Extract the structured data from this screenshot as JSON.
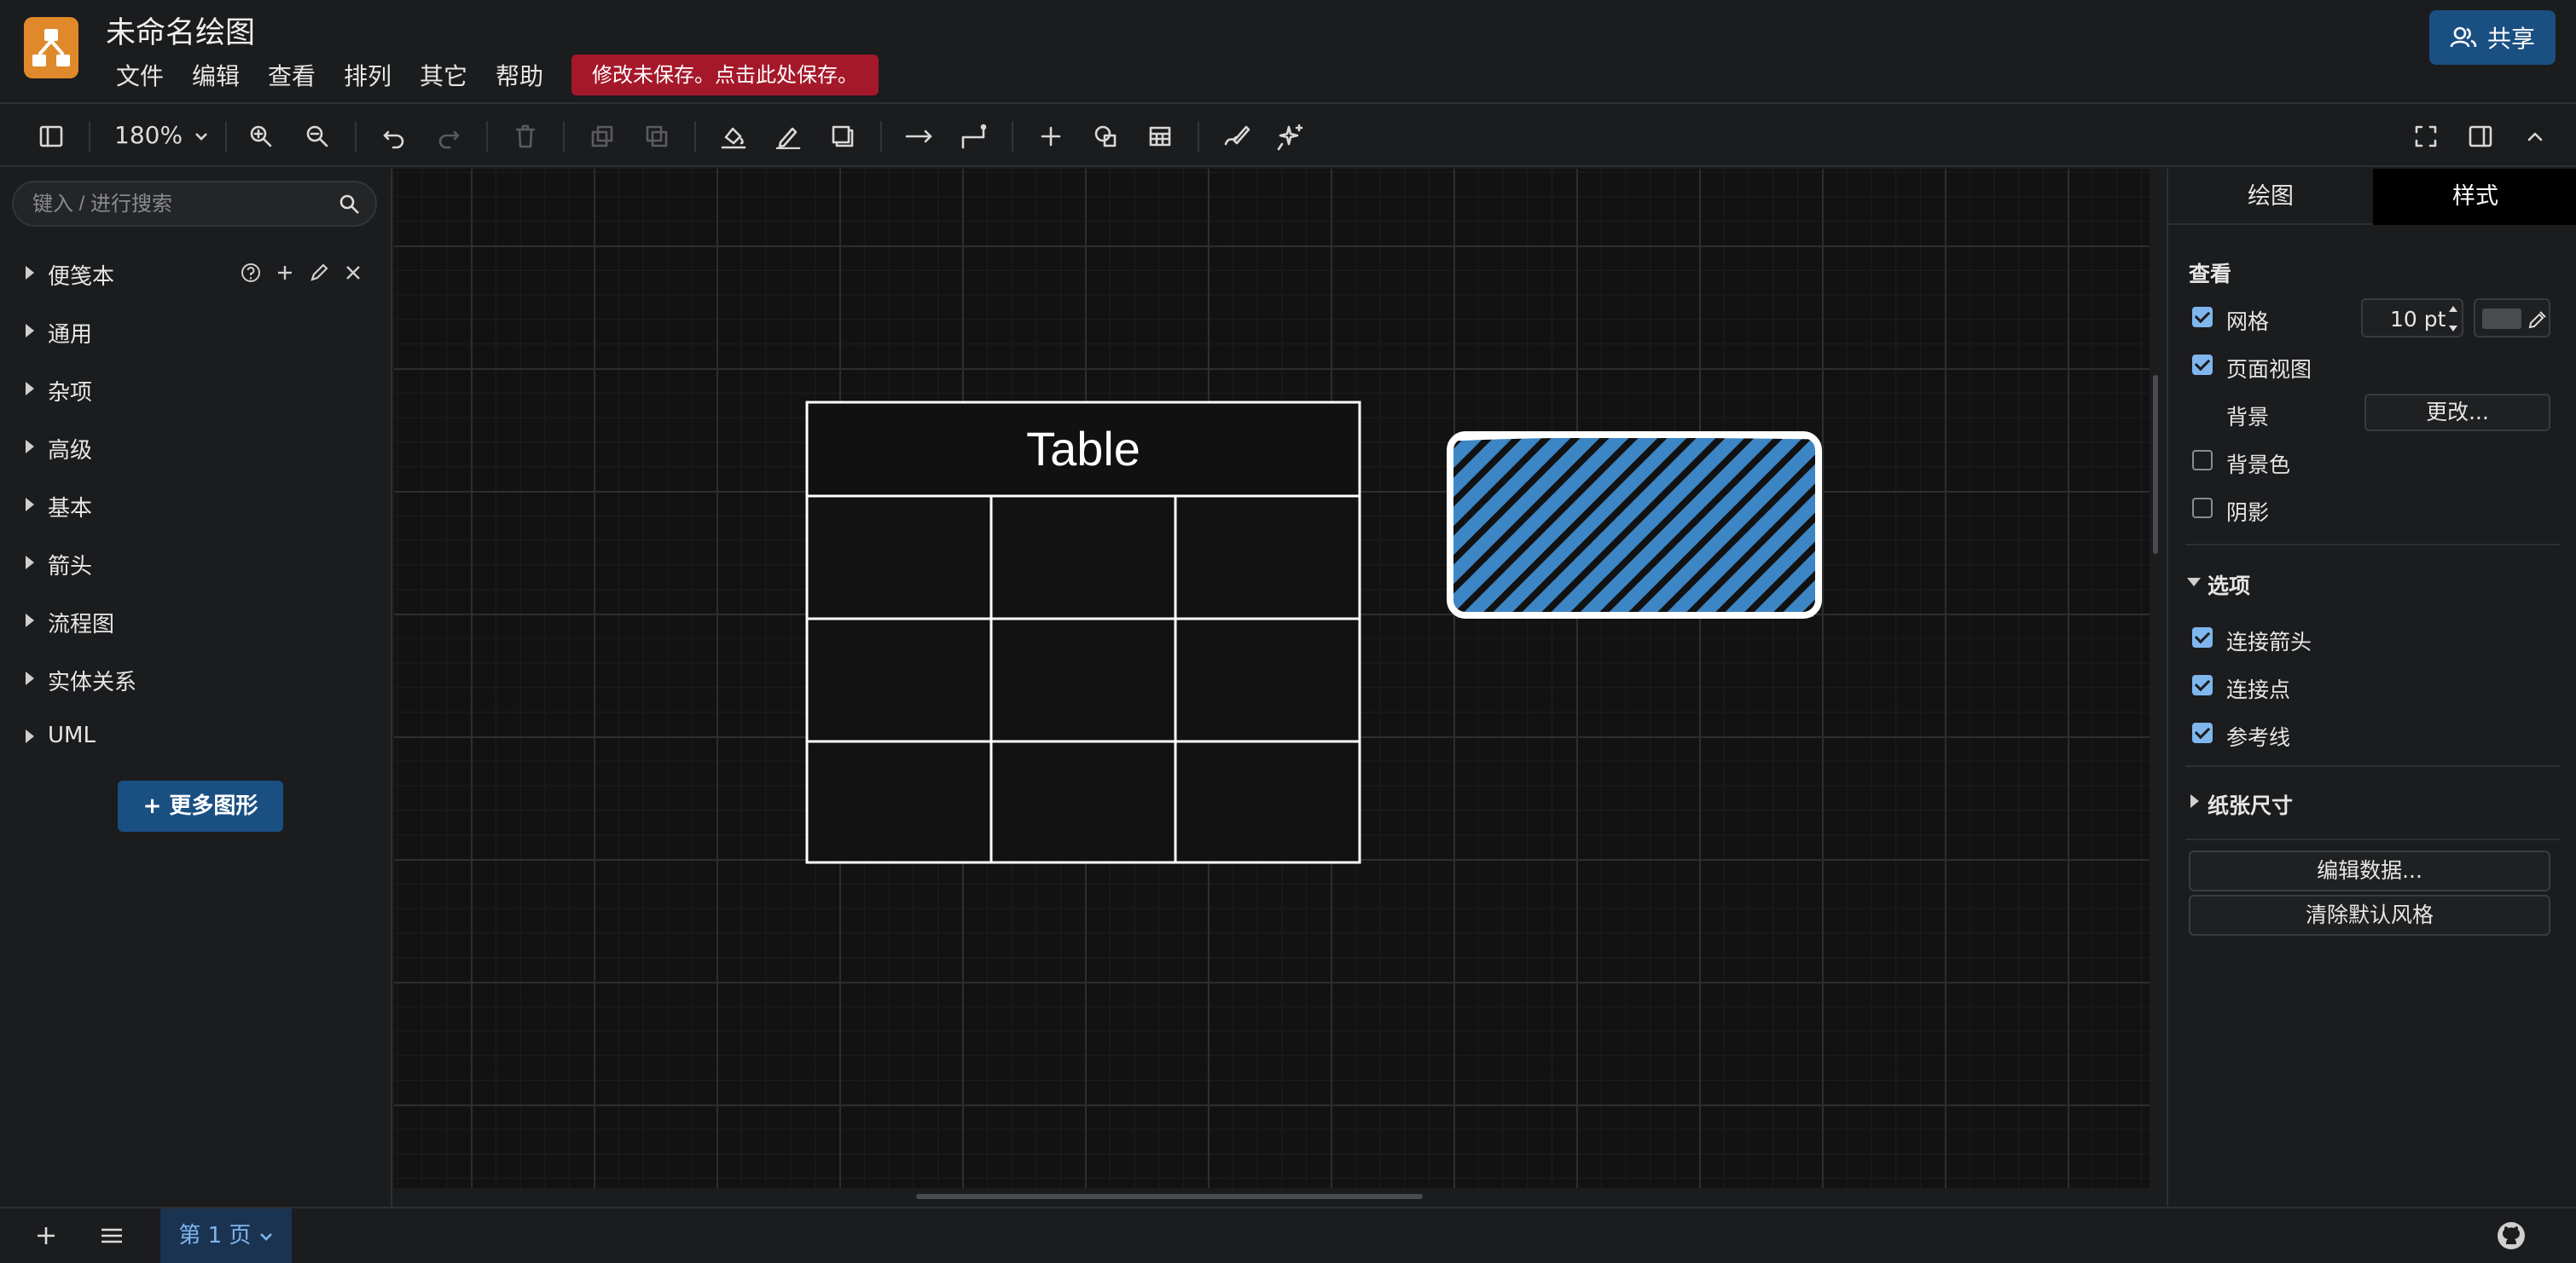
{
  "app": {
    "title": "未命名绘图"
  },
  "menu": [
    "文件",
    "编辑",
    "查看",
    "排列",
    "其它",
    "帮助"
  ],
  "unsaved_notice": "修改未保存。点击此处保存。",
  "share_label": "共享",
  "toolbar": {
    "zoom": "180%"
  },
  "sidebar": {
    "search_placeholder": "键入 / 进行搜索",
    "libraries": [
      "便笺本",
      "通用",
      "杂项",
      "高级",
      "基本",
      "箭头",
      "流程图",
      "实体关系",
      "UML"
    ],
    "more_shapes": "+ 更多图形"
  },
  "canvas": {
    "table_title": "Table",
    "hatch_fill_color": "#3d86c6",
    "hatch_bg_color": "#121212"
  },
  "panel": {
    "tabs": [
      "绘图",
      "样式"
    ],
    "view_section": "查看",
    "grid_label": "网格",
    "grid_checked": true,
    "grid_size": "10 pt",
    "page_view_label": "页面视图",
    "page_view_checked": true,
    "background_label": "背景",
    "change_button": "更改...",
    "bg_color_label": "背景色",
    "bg_color_checked": false,
    "shadow_label": "阴影",
    "shadow_checked": false,
    "options_section": "选项",
    "connection_arrows": "连接箭头",
    "connection_points": "连接点",
    "guides": "参考线",
    "paper_size": "纸张尺寸",
    "edit_data": "编辑数据...",
    "clear_default_style": "清除默认风格"
  },
  "footer": {
    "page_tab": "第 1 页"
  },
  "colors": {
    "accent": "#1a4f82",
    "alert": "#a5182a",
    "logo": "#e0892b",
    "checkbox": "#7fb6ee"
  }
}
